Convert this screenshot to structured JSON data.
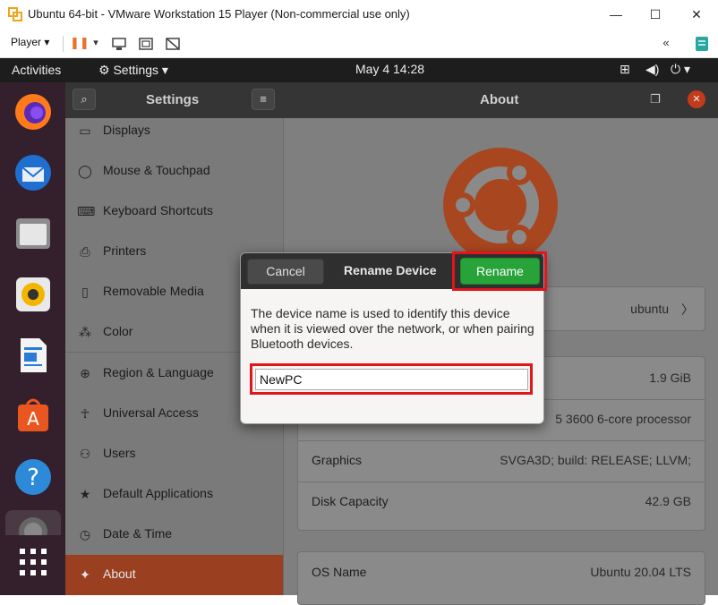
{
  "window": {
    "title": "Ubuntu 64-bit - VMware Workstation 15 Player (Non-commercial use only)",
    "minimize": "—",
    "maximize": "☐",
    "close": "✕"
  },
  "vm_toolbar": {
    "player_label": "Player ▾",
    "pause_icon": "❚❚",
    "dropdown": "▾",
    "fold_icon": "«"
  },
  "topbar": {
    "activities": "Activities",
    "app_menu": "⚙ Settings ▾",
    "clock": "May 4  14:28",
    "network_icon": "⊞",
    "volume_icon": "◀)",
    "power_icon": "⏻ ▾"
  },
  "settings_header": {
    "title": "Settings",
    "search_icon": "⌕",
    "menu_icon": "≡",
    "page_title": "About",
    "restore_icon": "❐",
    "close_icon": "✕"
  },
  "sidebar": {
    "items": [
      {
        "label": "Displays",
        "icon": "▭"
      },
      {
        "label": "Mouse & Touchpad",
        "icon": "◯"
      },
      {
        "label": "Keyboard Shortcuts",
        "icon": "⌨"
      },
      {
        "label": "Printers",
        "icon": "⎙"
      },
      {
        "label": "Removable Media",
        "icon": "▯"
      },
      {
        "label": "Color",
        "icon": "⁂"
      },
      {
        "label": "Region & Language",
        "icon": "⊕"
      },
      {
        "label": "Universal Access",
        "icon": "☥"
      },
      {
        "label": "Users",
        "icon": "⚇"
      },
      {
        "label": "Default Applications",
        "icon": "★"
      },
      {
        "label": "Date & Time",
        "icon": "◷"
      },
      {
        "label": "About",
        "icon": "✦"
      }
    ]
  },
  "about": {
    "device_name": "ubuntu",
    "memory": "1.9 GiB",
    "processor_partial": "5 3600 6-core processor",
    "graphics_label": "Graphics",
    "graphics_value": "SVGA3D; build: RELEASE; LLVM;",
    "disk_label": "Disk Capacity",
    "disk_value": "42.9 GB",
    "os_label": "OS Name",
    "os_value": "Ubuntu 20.04 LTS",
    "chevron": "〉"
  },
  "dialog": {
    "cancel": "Cancel",
    "title": "Rename Device",
    "rename": "Rename",
    "body": "The device name is used to identify this device when it is viewed over the network, or when pairing Bluetooth devices.",
    "input_value": "NewPC"
  },
  "colors": {
    "ubuntu_orange": "#e95420",
    "highlight_red": "#e0161b",
    "rename_green": "#27a33a"
  }
}
